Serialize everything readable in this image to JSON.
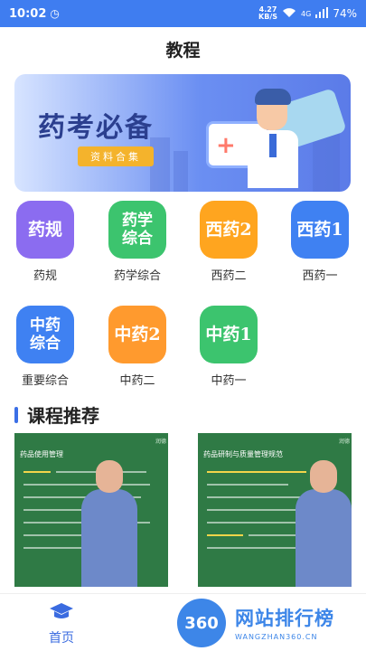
{
  "status": {
    "time": "10:02",
    "net_speed_value": "4.27",
    "net_speed_unit": "KB/S",
    "network": "4G",
    "battery": "74%"
  },
  "header": {
    "title": "教程"
  },
  "banner": {
    "headline": "药考必备",
    "tag": "资料合集"
  },
  "categories": [
    {
      "tile": "药规",
      "label": "药规",
      "color": "#8b6cf0"
    },
    {
      "tile": "药学综合",
      "label": "药学综合",
      "color": "#3cc46e"
    },
    {
      "tile": "西药2",
      "label": "西药二",
      "color": "#ffa51f"
    },
    {
      "tile": "西药1",
      "label": "西药一",
      "color": "#3f81f2"
    },
    {
      "tile": "中药综合",
      "label": "重要综合",
      "color": "#3f81f2"
    },
    {
      "tile": "中药2",
      "label": "中药二",
      "color": "#ff9a2e"
    },
    {
      "tile": "中药1",
      "label": "中药一",
      "color": "#3cc46e"
    }
  ],
  "section": {
    "title": "课程推荐"
  },
  "courses": [
    {
      "title": "药品使用管理",
      "corner": "润德"
    },
    {
      "title": "药品研制与质量管理规范",
      "corner": "润德"
    }
  ],
  "tabbar": {
    "home_label": "首页"
  },
  "watermark": {
    "badge": "360",
    "title": "网站排行榜",
    "url": "WANGZHAN360.CN"
  }
}
